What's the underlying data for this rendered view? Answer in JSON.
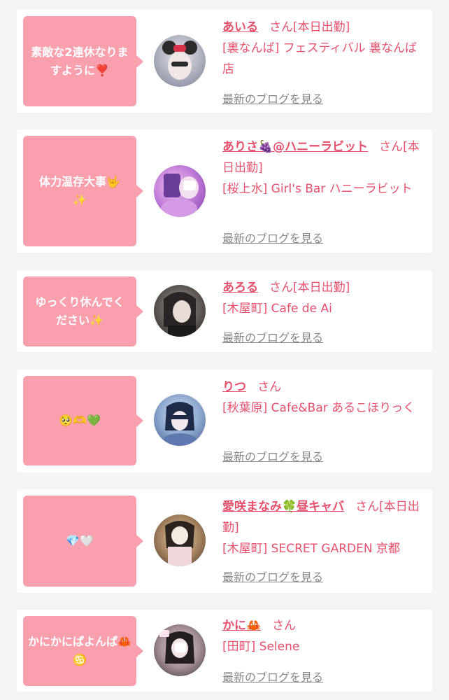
{
  "cards": [
    {
      "bubble": "素敵な2連休なりますように❣️",
      "name": "あいる",
      "san": "さん[本日出勤]",
      "shop": "[裏なんば] フェスティバル 裏なんば店",
      "blog": "最新のブログを見る"
    },
    {
      "bubble": "体力温存大事🤟✨",
      "name": "ありさ🍇@ハニーラビット",
      "san": "さん[本日出勤]",
      "shop": "[桜上水] Girl's Bar ハニーラビット",
      "blog": "最新のブログを見る"
    },
    {
      "bubble": "ゆっくり休んでください✨",
      "name": "あろる",
      "san": "さん[本日出勤]",
      "shop": "[木屋町] Cafe de Ai",
      "blog": "最新のブログを見る"
    },
    {
      "bubble": "🥺🫶💚",
      "name": "りつ",
      "san": "さん",
      "shop": "[秋葉原] Cafe&Bar あるこほりっく",
      "blog": "最新のブログを見る"
    },
    {
      "bubble": "💎🤍",
      "name": "愛咲まなみ🍀昼キャバ",
      "san": "さん[本日出勤]",
      "shop": "[木屋町] SECRET GARDEN 京都",
      "blog": "最新のブログを見る"
    },
    {
      "bubble": "かにかにぱよんぱ🦀♋️",
      "name": "かに🦀",
      "san": "さん",
      "shop": "[田町] Selene",
      "blog": "最新のブログを見る"
    }
  ],
  "colors": {
    "accent": "#e5506e",
    "bubble": "#f99fae",
    "link_gray": "#888888"
  }
}
